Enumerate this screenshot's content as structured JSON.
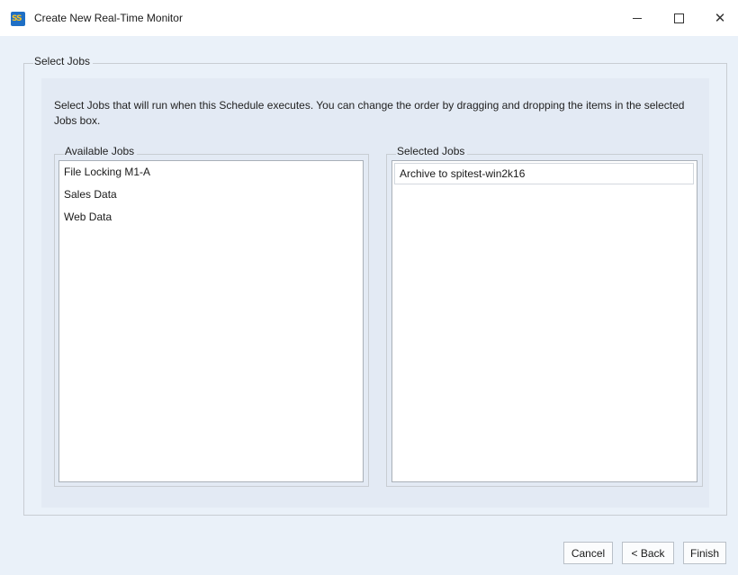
{
  "window": {
    "title": "Create New Real-Time Monitor",
    "icon_label": "SS",
    "controls": {
      "minimize_icon": "minimize-icon",
      "maximize_icon": "maximize-icon",
      "close_icon": "close-icon",
      "close_glyph": "✕"
    }
  },
  "select_jobs": {
    "group_title": "Select Jobs",
    "description": "Select Jobs that will run when this Schedule executes. You can change the order by dragging and dropping the items in the selected Jobs box.",
    "available": {
      "title": "Available Jobs",
      "items": [
        "File Locking M1-A",
        "Sales Data",
        "Web Data"
      ]
    },
    "selected": {
      "title": "Selected Jobs",
      "items": [
        "Archive to spitest-win2k16"
      ]
    }
  },
  "footer": {
    "cancel_label": "Cancel",
    "back_label": "< Back",
    "finish_label": "Finish"
  },
  "colors": {
    "client_bg": "#eaf1f9",
    "panel_bg": "#e3eaf4",
    "icon_blue": "#1f6fc5",
    "icon_yellow": "#f7c326"
  }
}
